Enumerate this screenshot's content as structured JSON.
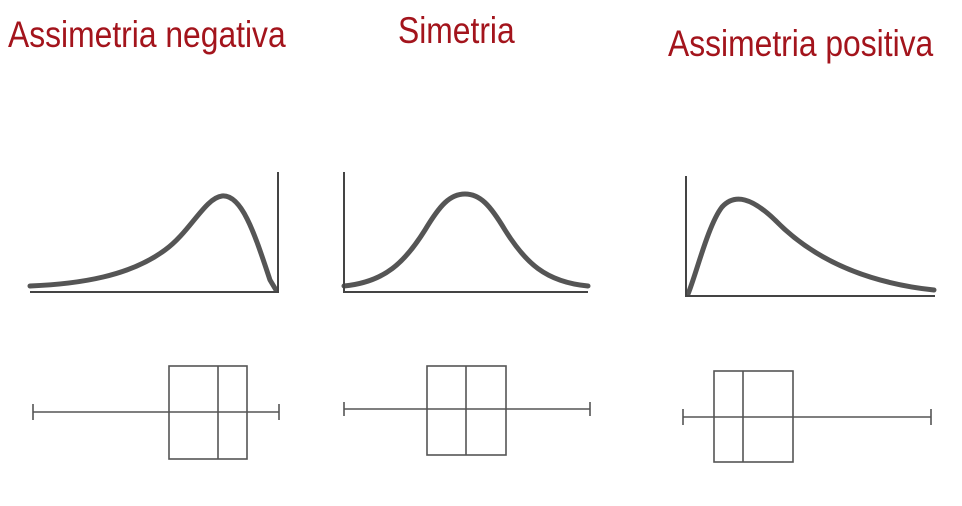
{
  "titles": {
    "negative": "Assimetria negativa",
    "symmetric": "Simetria",
    "positive": "Assimetria positiva"
  },
  "colors": {
    "title": "#a3141c",
    "curve": "#555555",
    "axis": "#444444",
    "box": "#555555"
  }
}
